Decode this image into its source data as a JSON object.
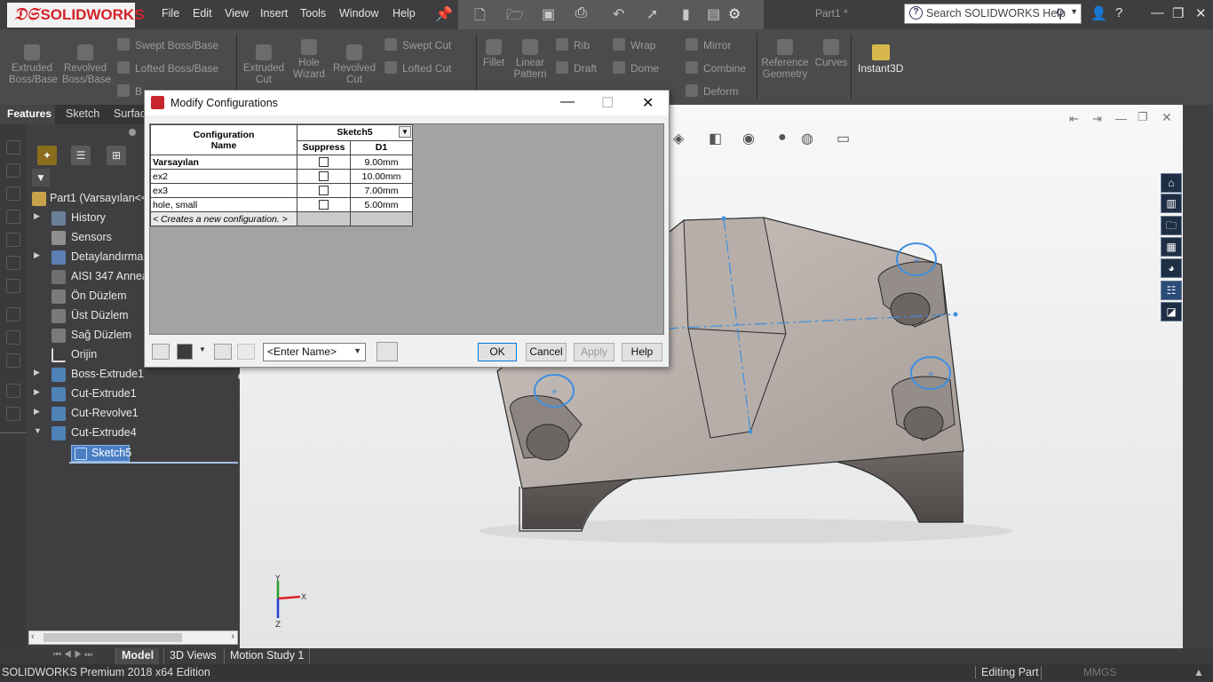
{
  "app": {
    "name": "SOLIDWORKS",
    "doc_title": "Part1 *",
    "search_placeholder": "Search SOLIDWORKS Help"
  },
  "menu": [
    "File",
    "Edit",
    "View",
    "Insert",
    "Tools",
    "Window",
    "Help"
  ],
  "command_manager": {
    "extruded_boss": "Extruded\nBoss/Base",
    "revolved_boss": "Revolved\nBoss/Base",
    "swept_boss": "Swept Boss/Base",
    "lofted_boss": "Lofted Boss/Base",
    "boundary_boss": "B",
    "extruded_cut": "Extruded\nCut",
    "hole_wizard": "Hole\nWizard",
    "revolved_cut": "Revolved\nCut",
    "swept_cut": "Swept Cut",
    "lofted_cut": "Lofted Cut",
    "fillet": "Fillet",
    "linear_pattern": "Linear\nPattern",
    "rib": "Rib",
    "draft": "Draft",
    "wrap": "Wrap",
    "dome": "Dome",
    "mirror": "Mirror",
    "combine": "Combine",
    "deform": "Deform",
    "reference_geometry": "Reference\nGeometry",
    "curves": "Curves",
    "instant3d": "Instant3D"
  },
  "panel_tabs": {
    "features": "Features",
    "sketch": "Sketch",
    "surfaces": "Surfac"
  },
  "tree": [
    {
      "label": "Part1  (Varsayılan<<",
      "expand": ""
    },
    {
      "label": "History",
      "expand": "▶"
    },
    {
      "label": "Sensors",
      "expand": ""
    },
    {
      "label": "Detaylandırmal",
      "expand": "▶"
    },
    {
      "label": "AISI 347 Anneal",
      "expand": ""
    },
    {
      "label": "Ön Düzlem",
      "expand": ""
    },
    {
      "label": "Üst Düzlem",
      "expand": ""
    },
    {
      "label": "Sağ Düzlem",
      "expand": ""
    },
    {
      "label": "Orijin",
      "expand": ""
    },
    {
      "label": "Boss-Extrude1",
      "expand": "▶"
    },
    {
      "label": "Cut-Extrude1",
      "expand": "▶"
    },
    {
      "label": "Cut-Revolve1",
      "expand": "▶"
    },
    {
      "label": "Cut-Extrude4",
      "expand": "▼"
    },
    {
      "label": "Sketch5",
      "expand": ""
    }
  ],
  "bottom_tabs": [
    "Model",
    "3D Views",
    "Motion Study 1"
  ],
  "status": {
    "edition": "SOLIDWORKS Premium 2018 x64 Edition",
    "mode": "Editing Part",
    "units": "MMGS"
  },
  "dialog": {
    "title": "Modify Configurations",
    "header_config": "Configuration\nName",
    "header_sketch": "Sketch5",
    "header_suppress": "Suppress",
    "header_d1": "D1",
    "rows": [
      {
        "name": "Varsayılan",
        "d1": "9.00mm",
        "bold": true
      },
      {
        "name": "ex2",
        "d1": "10.00mm",
        "bold": false
      },
      {
        "name": "ex3",
        "d1": "7.00mm",
        "bold": false
      },
      {
        "name": "hole, small",
        "d1": "5.00mm",
        "bold": false
      }
    ],
    "new_config": "< Creates a new configuration. >",
    "name_select": "<Enter Name>",
    "ok": "OK",
    "cancel": "Cancel",
    "apply": "Apply",
    "help": "Help"
  },
  "triad": {
    "y": "Y",
    "x": "X",
    "z": "Z"
  }
}
